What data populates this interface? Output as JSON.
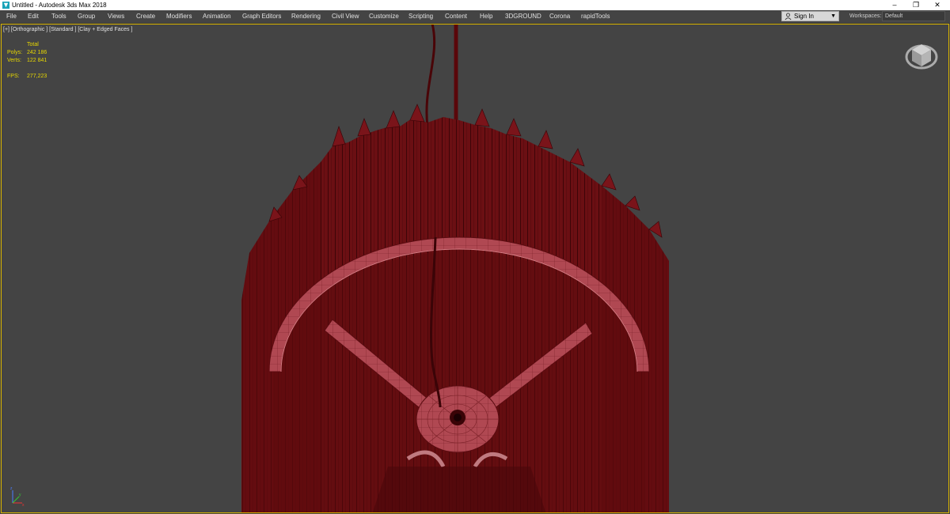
{
  "titlebar": {
    "title": "Untitled - Autodesk 3ds Max 2018",
    "minimize": "–",
    "restore": "❐",
    "close": "✕"
  },
  "menu": [
    "File",
    "Edit",
    "Tools",
    "Group",
    "Views",
    "Create",
    "Modifiers",
    "Animation",
    "Graph Editors",
    "Rendering",
    "Civil View",
    "Customize",
    "Scripting",
    "Content",
    "Help",
    "3DGROUND",
    "Corona",
    "rapidTools"
  ],
  "account": {
    "label": "Sign In"
  },
  "workspaces": {
    "label": "Workspaces:",
    "value": "Default"
  },
  "viewport": {
    "label": "[+] [Orthographic ] [Standard ] [Clay + Edged Faces ]",
    "stats": {
      "header": "Total",
      "polys_label": "Polys:",
      "polys": "242 186",
      "verts_label": "Verts:",
      "verts": "122 841",
      "fps_label": "FPS:",
      "fps": "277,223"
    }
  },
  "colors": {
    "viewport_bg": "#444444",
    "active_border": "#d8b400",
    "stats_text": "#e8d800",
    "mesh_dark": "#6a0e12",
    "mesh_light": "#b54a52"
  }
}
